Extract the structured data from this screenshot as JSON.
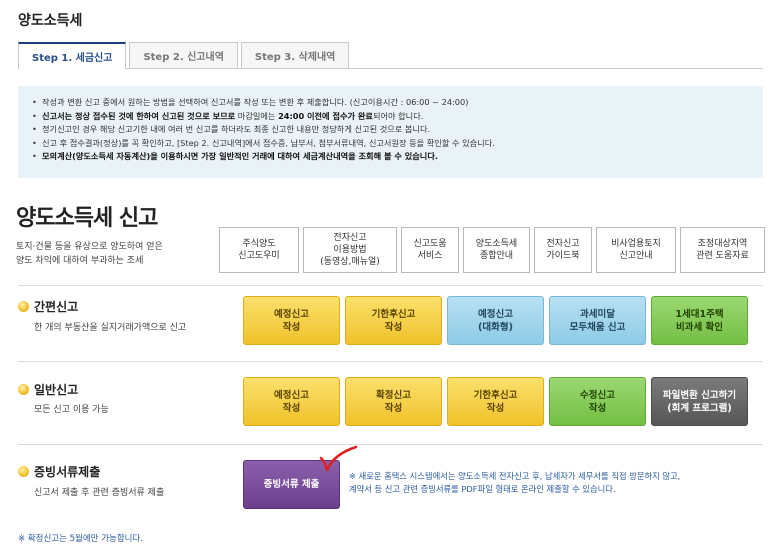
{
  "page": {
    "title": "양도소득세"
  },
  "tabs": [
    {
      "label": "Step 1. 세금신고",
      "active": true
    },
    {
      "label": "Step 2. 신고내역",
      "active": false
    },
    {
      "label": "Step 3. 삭제내역",
      "active": false
    }
  ],
  "notice": {
    "line1": "작성과 변환 신고 중에서 원하는 방법을 선택하여 신고서를 작성 또는 변환 후 제출합니다. (신고이용시간 : 06:00 ~ 24:00)",
    "line2_a": "신고서는 정상 접수된 것에 한하여 신고된 것으로 보므로",
    "line2_b": " 마감일에는 ",
    "line2_c": "24:00 이전에 접수가 완료",
    "line2_d": "되어야 합니다.",
    "line3": "정기신고인 경우 해당 신고기한 내에 여러 번 신고를 하더라도 최종 신고한 내용만 정당하게 신고된 것으로 봅니다.",
    "line4": "신고 후 접수결과(정상)를 꼭 확인하고, [Step 2. 신고내역]에서 접수증, 납부서, 첨부서류내역, 신고서원장 등을 확인할 수 있습니다.",
    "line5": "모의계산(양도소득세 자동계산)을 이용하시면 가장 일반적인 거래에 대하여 세금계산내역을 조회해 볼 수 있습니다."
  },
  "section": {
    "title": "양도소득세 신고",
    "desc_line1": "토지·건물 등을 유상으로 양도하여 얻은",
    "desc_line2": "양도 차익에 대하여 부과하는 조세"
  },
  "quick_links": [
    {
      "label": "주식양도\n신고도우미"
    },
    {
      "label": "전자신고\n이용방법\n(동영상,매뉴얼)"
    },
    {
      "label": "신고도움\n서비스"
    },
    {
      "label": "양도소득세\n종합안내"
    },
    {
      "label": "전자신고\n가이드북"
    },
    {
      "label": "비사업용토지\n신고안내"
    },
    {
      "label": "조정대상지역\n관련 도움자료"
    }
  ],
  "simple": {
    "title": "간편신고",
    "desc": "한 개의 부동산을 실지거래가액으로 신고",
    "buttons": [
      {
        "label": "예정신고\n작성",
        "color": "yellow"
      },
      {
        "label": "기한후신고\n작성",
        "color": "yellow"
      },
      {
        "label": "예정신고\n(대화형)",
        "color": "blue"
      },
      {
        "label": "과세미달\n모두채움 신고",
        "color": "blue"
      },
      {
        "label": "1세대1주택\n비과세 확인",
        "color": "green"
      }
    ]
  },
  "general": {
    "title": "일반신고",
    "desc": "모든 신고 이용 가능",
    "buttons": [
      {
        "label": "예정신고\n작성",
        "color": "yellow"
      },
      {
        "label": "확정신고\n작성",
        "color": "yellow"
      },
      {
        "label": "기한후신고\n작성",
        "color": "yellow"
      },
      {
        "label": "수정신고\n작성",
        "color": "green"
      },
      {
        "label": "파일변환 신고하기\n(회계 프로그램)",
        "color": "gray"
      }
    ]
  },
  "cert": {
    "title": "증빙서류제출",
    "desc": "신고서 제출 후 관련 증빙서류 제출",
    "button": "증빙서류 제출",
    "note_line1": "※ 새로운 홈택스 시스템에서는 양도소득세 전자신고 후, 납세자가 세무서를 직접 방문하지 않고,",
    "note_line2": "계약서 등 신고 관련 증빙서류를 PDF파일 형태로 온라인 제출할 수 있습니다."
  },
  "footnote": "※ 확정신고는 5월에만 가능합니다.",
  "colors": {
    "yellow": "#f0c22a",
    "blue": "#8ccbe6",
    "green": "#73bf44",
    "gray": "#565656",
    "purple": "#6b3f8e",
    "annotation": "#e02020"
  }
}
